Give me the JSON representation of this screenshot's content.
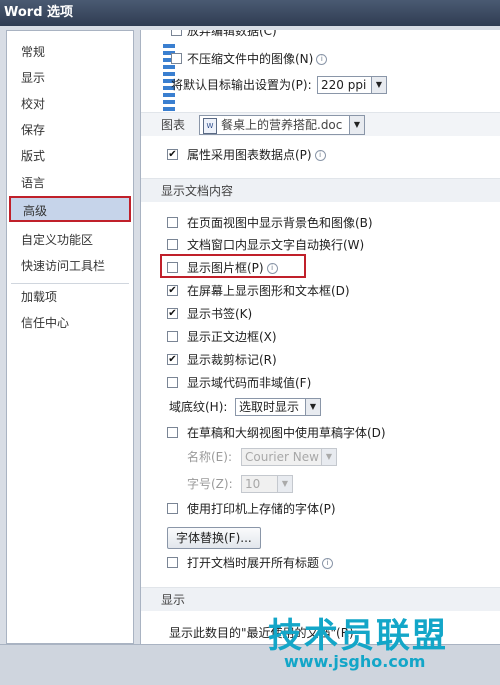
{
  "window": {
    "title": "Word 选项"
  },
  "sidebar": {
    "items": [
      {
        "label": "常规"
      },
      {
        "label": "显示"
      },
      {
        "label": "校对"
      },
      {
        "label": "保存"
      },
      {
        "label": "版式"
      },
      {
        "label": "语言"
      },
      {
        "label": "高级",
        "selected": true
      },
      {
        "label": "自定义功能区"
      },
      {
        "label": "快速访问工具栏"
      },
      {
        "label": "加载项"
      },
      {
        "label": "信任中心"
      }
    ]
  },
  "top": {
    "partial_label": "放弃编辑数据(C)",
    "no_compress_label": "不压缩文件中的图像(N)",
    "default_target_label": "将默认目标输出设置为(P):",
    "default_target_value": "220 ppi",
    "chart_label": "图表",
    "chart_doc": "餐桌上的营养搭配.doc",
    "chart_attr_label": "属性采用图表数据点(P)"
  },
  "show_doc_section": {
    "heading": "显示文档内容",
    "options": [
      {
        "label": "在页面视图中显示背景色和图像(B)",
        "checked": false
      },
      {
        "label": "文档窗口内显示文字自动换行(W)",
        "checked": false
      },
      {
        "label": "显示图片框(P)",
        "checked": false
      },
      {
        "label": "在屏幕上显示图形和文本框(D)",
        "checked": true
      },
      {
        "label": "显示书签(K)",
        "checked": true
      },
      {
        "label": "显示正文边框(X)",
        "checked": false
      },
      {
        "label": "显示裁剪标记(R)",
        "checked": true
      },
      {
        "label": "显示域代码而非域值(F)",
        "checked": false
      }
    ],
    "field_shading_label": "域底纹(H):",
    "field_shading_value": "选取时显示",
    "draft_font_label": "在草稿和大纲视图中使用草稿字体(D)",
    "name_label": "名称(E):",
    "name_value": "Courier New",
    "size_label": "字号(Z):",
    "size_value": "10",
    "printer_fonts_label": "使用打印机上存储的字体(P)",
    "font_sub_button": "字体替换(F)...",
    "expand_headings_label": "打开文档时展开所有标题"
  },
  "display_section": {
    "heading": "显示",
    "recent_label": "显示此数目的\"最近使用的文档\"(R):"
  },
  "watermark": {
    "main": "技术员联盟",
    "url": "www.jsgho.com"
  },
  "marks": {
    "check": "✔",
    "arrow": "▼",
    "info": "i",
    "doc": "W"
  }
}
